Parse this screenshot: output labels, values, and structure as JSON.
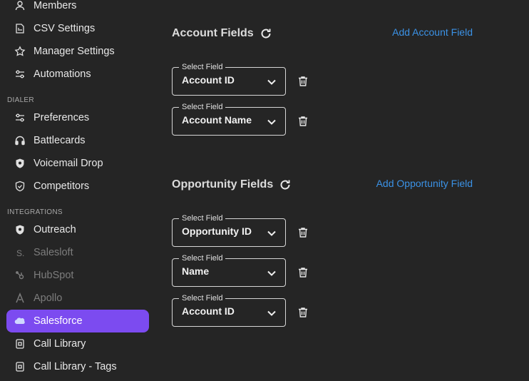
{
  "sidebar": {
    "items_top": [
      {
        "label": "Members",
        "icon": "user-icon"
      },
      {
        "label": "CSV Settings",
        "icon": "csv-file-icon"
      },
      {
        "label": "Manager Settings",
        "icon": "star-icon"
      },
      {
        "label": "Automations",
        "icon": "sliders-icon"
      }
    ],
    "dialer_label": "DIALER",
    "dialer_items": [
      {
        "label": "Preferences",
        "icon": "sliders-icon"
      },
      {
        "label": "Battlecards",
        "icon": "headphones-icon"
      },
      {
        "label": "Voicemail Drop",
        "icon": "shield-icon"
      },
      {
        "label": "Competitors",
        "icon": "shield-check-icon"
      }
    ],
    "integrations_label": "INTEGRATIONS",
    "integration_items": [
      {
        "label": "Outreach",
        "icon": "outreach-icon",
        "state": "enabled"
      },
      {
        "label": "Salesloft",
        "icon": "salesloft-icon",
        "state": "disabled"
      },
      {
        "label": "HubSpot",
        "icon": "hubspot-icon",
        "state": "disabled"
      },
      {
        "label": "Apollo",
        "icon": "apollo-icon",
        "state": "disabled"
      },
      {
        "label": "Salesforce",
        "icon": "salesforce-icon",
        "state": "active"
      },
      {
        "label": "Call Library",
        "icon": "library-icon",
        "state": "enabled"
      },
      {
        "label": "Call Library - Tags",
        "icon": "library-icon",
        "state": "enabled"
      }
    ]
  },
  "account": {
    "title": "Account Fields",
    "add_label": "Add Account Field",
    "fields": [
      {
        "legend": "Select Field",
        "value": "Account ID"
      },
      {
        "legend": "Select Field",
        "value": "Account Name"
      }
    ]
  },
  "opportunity": {
    "title": "Opportunity Fields",
    "add_label": "Add Opportunity Field",
    "fields": [
      {
        "legend": "Select Field",
        "value": "Opportunity ID"
      },
      {
        "legend": "Select Field",
        "value": "Name"
      },
      {
        "legend": "Select Field",
        "value": "Account ID"
      }
    ]
  },
  "colors": {
    "accent": "#7c4bf0",
    "link": "#3b92e6",
    "background": "#252525"
  }
}
